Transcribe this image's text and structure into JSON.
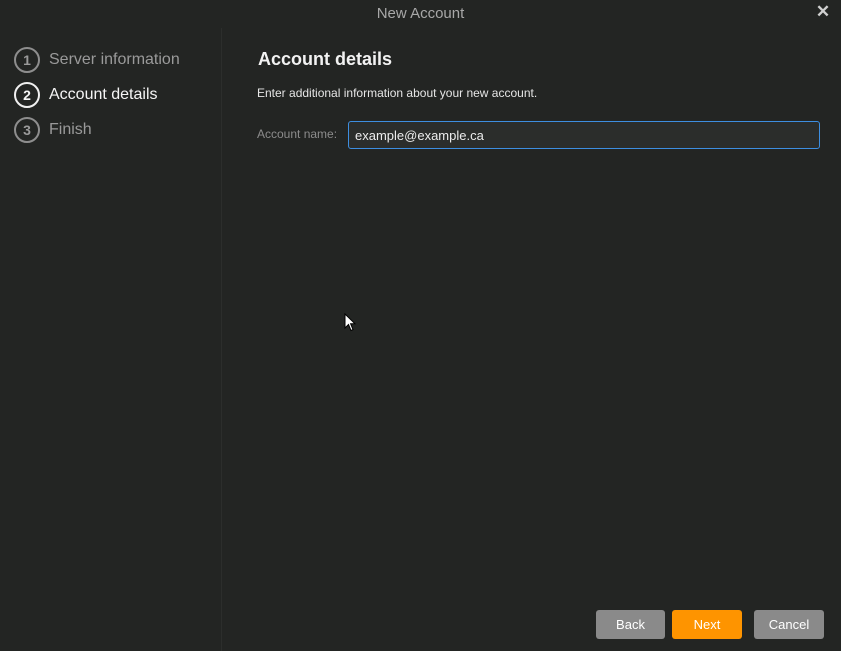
{
  "window": {
    "title": "New Account",
    "close_icon": "close-icon"
  },
  "sidebar": {
    "steps": [
      {
        "number": "1",
        "label": "Server information",
        "active": false
      },
      {
        "number": "2",
        "label": "Account details",
        "active": true
      },
      {
        "number": "3",
        "label": "Finish",
        "active": false
      }
    ]
  },
  "main": {
    "title": "Account details",
    "description": "Enter additional information about your new account.",
    "account_name": {
      "label": "Account name:",
      "value": "example@example.ca"
    }
  },
  "buttons": {
    "back": "Back",
    "next": "Next",
    "cancel": "Cancel"
  },
  "colors": {
    "background": "#232523",
    "accent": "#fe9400",
    "focus": "#3d8ee0",
    "secondary_button": "#8a8a8a"
  }
}
